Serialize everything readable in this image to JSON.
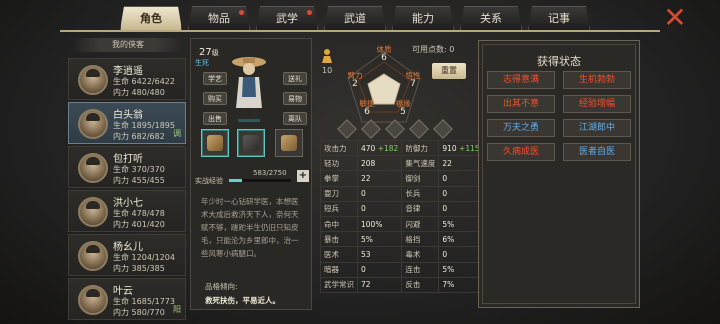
{
  "tabs": [
    {
      "label": "角色",
      "active": true,
      "dot": false
    },
    {
      "label": "物品",
      "active": false,
      "dot": true
    },
    {
      "label": "武学",
      "active": false,
      "dot": true
    },
    {
      "label": "武道",
      "active": false,
      "dot": false
    },
    {
      "label": "能力",
      "active": false,
      "dot": false
    },
    {
      "label": "关系",
      "active": false,
      "dot": false
    },
    {
      "label": "记事",
      "active": false,
      "dot": false
    }
  ],
  "list_header": "我的侠客",
  "heroes": [
    {
      "name": "李逍遥",
      "hp_label": "生命",
      "hp": "6422/6422",
      "mp_label": "内力",
      "mp": "480/480",
      "selected": false,
      "tag": ""
    },
    {
      "name": "白头翁",
      "hp_label": "生命",
      "hp": "1895/1895",
      "mp_label": "内力",
      "mp": "682/682",
      "selected": true,
      "tag": "调"
    },
    {
      "name": "包打听",
      "hp_label": "生命",
      "hp": "370/370",
      "mp_label": "内力",
      "mp": "455/455",
      "selected": false,
      "tag": ""
    },
    {
      "name": "洪小七",
      "hp_label": "生命",
      "hp": "478/478",
      "mp_label": "内力",
      "mp": "401/420",
      "selected": false,
      "tag": ""
    },
    {
      "name": "杨幺儿",
      "hp_label": "生命",
      "hp": "1204/1204",
      "mp_label": "内力",
      "mp": "385/385",
      "selected": false,
      "tag": ""
    },
    {
      "name": "叶云",
      "hp_label": "生命",
      "hp": "1685/1773",
      "mp_label": "内力",
      "mp": "580/770",
      "selected": false,
      "tag": "阳"
    }
  ],
  "profile": {
    "level": "27",
    "level_unit": "级",
    "state": "生死",
    "buttons": {
      "skill": "学艺",
      "gift": "送礼",
      "buy": "购买",
      "trade": "易物",
      "sell": "出售",
      "leave": "离队"
    },
    "exp_label": "实战经验",
    "exp_value": "583/2750",
    "exp_fraction": 0.212,
    "plus": "+",
    "bio": "年少时一心钻研学医，本想医术大成后救济天下人，奈何天赋不够，蹉跎半生仍旧只知皮毛，只能沦为乡里郎中，治一些风寒小病腿口。",
    "trait_title": "品格倾向:",
    "trait": "救死扶伤，平易近人。"
  },
  "stats": {
    "points_label": "可用点数:",
    "points": "0",
    "reset": "重置",
    "person_num": "10",
    "attrs": {
      "tizhi": {
        "label": "体质",
        "value": "6"
      },
      "biili": {
        "label": "臂力",
        "value": "2"
      },
      "wuxing": {
        "label": "悟性",
        "value": "7"
      },
      "minjie": {
        "label": "敏捷",
        "value": "6"
      },
      "fuyuan": {
        "label": "福缘",
        "value": "5"
      }
    },
    "table": [
      {
        "k1": "攻击力",
        "v1": "470",
        "b1": "+182",
        "k2": "防御力",
        "v2": "910",
        "b2": "+115"
      },
      {
        "k1": "轻功",
        "v1": "208",
        "b1": "",
        "k2": "集气速度",
        "v2": "22",
        "b2": ""
      },
      {
        "k1": "拳掌",
        "v1": "22",
        "b1": "",
        "k2": "御剑",
        "v2": "0",
        "b2": ""
      },
      {
        "k1": "耍刀",
        "v1": "0",
        "b1": "",
        "k2": "长兵",
        "v2": "0",
        "b2": ""
      },
      {
        "k1": "短兵",
        "v1": "0",
        "b1": "",
        "k2": "音律",
        "v2": "0",
        "b2": ""
      },
      {
        "k1": "命中",
        "v1": "100%",
        "b1": "",
        "k2": "闪避",
        "v2": "5%",
        "b2": ""
      },
      {
        "k1": "暴击",
        "v1": "5%",
        "b1": "",
        "k2": "格挡",
        "v2": "6%",
        "b2": ""
      },
      {
        "k1": "医术",
        "v1": "53",
        "b1": "",
        "k2": "毒术",
        "v2": "0",
        "b2": ""
      },
      {
        "k1": "暗器",
        "v1": "0",
        "b1": "",
        "k2": "连击",
        "v2": "5%",
        "b2": ""
      },
      {
        "k1": "武学常识",
        "v1": "72",
        "b1": "",
        "k2": "反击",
        "v2": "7%",
        "b2": ""
      }
    ]
  },
  "status_panel": {
    "title": "获得状态",
    "items": [
      {
        "label": "志得意满",
        "color": "red"
      },
      {
        "label": "生机勃勃",
        "color": "red"
      },
      {
        "label": "出其不意",
        "color": "red"
      },
      {
        "label": "经验增幅",
        "color": "red"
      },
      {
        "label": "万夫之勇",
        "color": "blue"
      },
      {
        "label": "江湖郎中",
        "color": "blue"
      },
      {
        "label": "久病成医",
        "color": "red"
      },
      {
        "label": "医者自医",
        "color": "blue"
      }
    ]
  },
  "colors": {
    "accent": "#e07a3c",
    "buff_red": "#f0522e",
    "buff_blue": "#66aee8",
    "teal": "#67d2c4"
  },
  "icons": {
    "close": "close-x-icon",
    "person": "person-icon"
  }
}
